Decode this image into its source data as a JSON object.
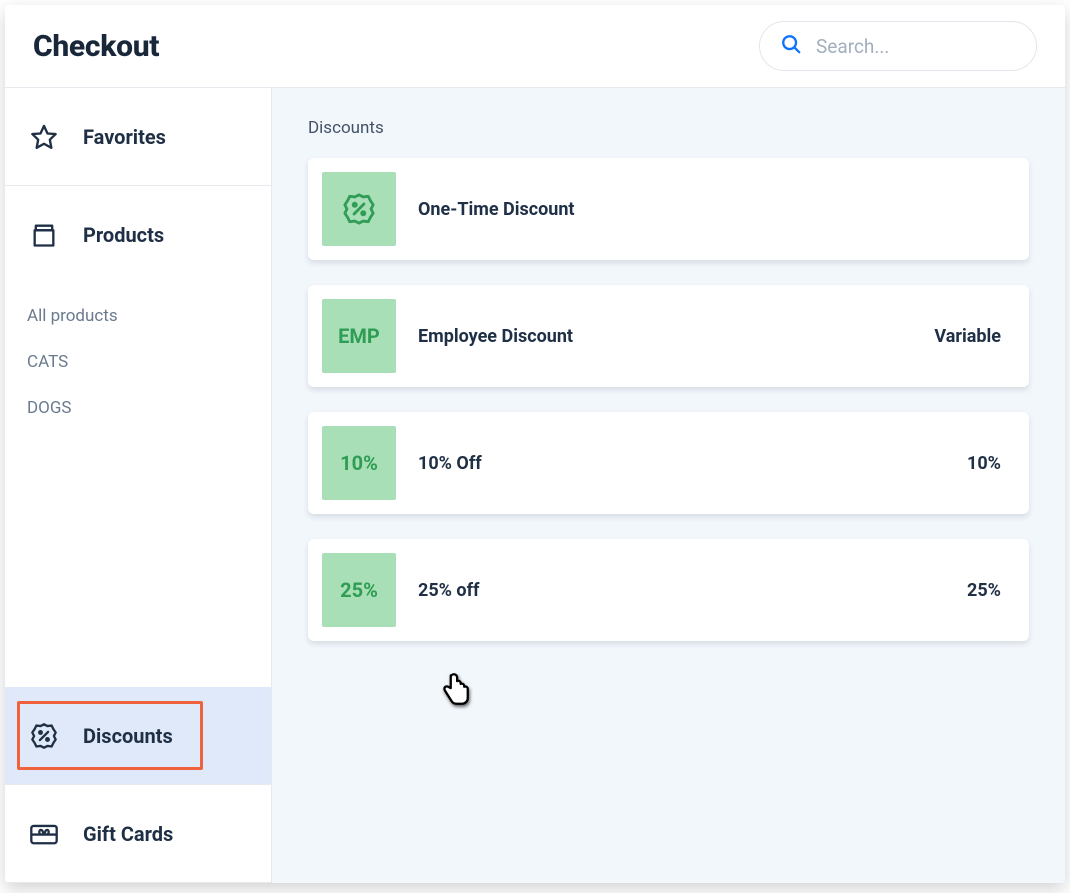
{
  "header": {
    "title": "Checkout",
    "search_placeholder": "Search..."
  },
  "sidebar": {
    "favorites": {
      "label": "Favorites",
      "icon": "star-icon"
    },
    "products": {
      "label": "Products",
      "icon": "box-icon"
    },
    "discounts": {
      "label": "Discounts",
      "icon": "percent-badge-icon"
    },
    "giftcards": {
      "label": "Gift Cards",
      "icon": "gift-card-icon"
    },
    "sub_items": [
      "All products",
      "CATS",
      "DOGS"
    ]
  },
  "main": {
    "heading": "Discounts",
    "rows": [
      {
        "thumb_kind": "icon",
        "thumb_text": "",
        "title": "One-Time Discount",
        "value": ""
      },
      {
        "thumb_kind": "text",
        "thumb_text": "EMP",
        "title": "Employee Discount",
        "value": "Variable"
      },
      {
        "thumb_kind": "text",
        "thumb_text": "10%",
        "title": "10% Off",
        "value": "10%"
      },
      {
        "thumb_kind": "text",
        "thumb_text": "25%",
        "title": "25% off",
        "value": "25%"
      }
    ]
  },
  "colors": {
    "accent_green": "#2f9d55",
    "thumb_bg": "#a9dfb6",
    "highlight_border": "#f0623e",
    "highlight_fill": "#dfe9f9",
    "search_icon": "#0b73ff"
  }
}
